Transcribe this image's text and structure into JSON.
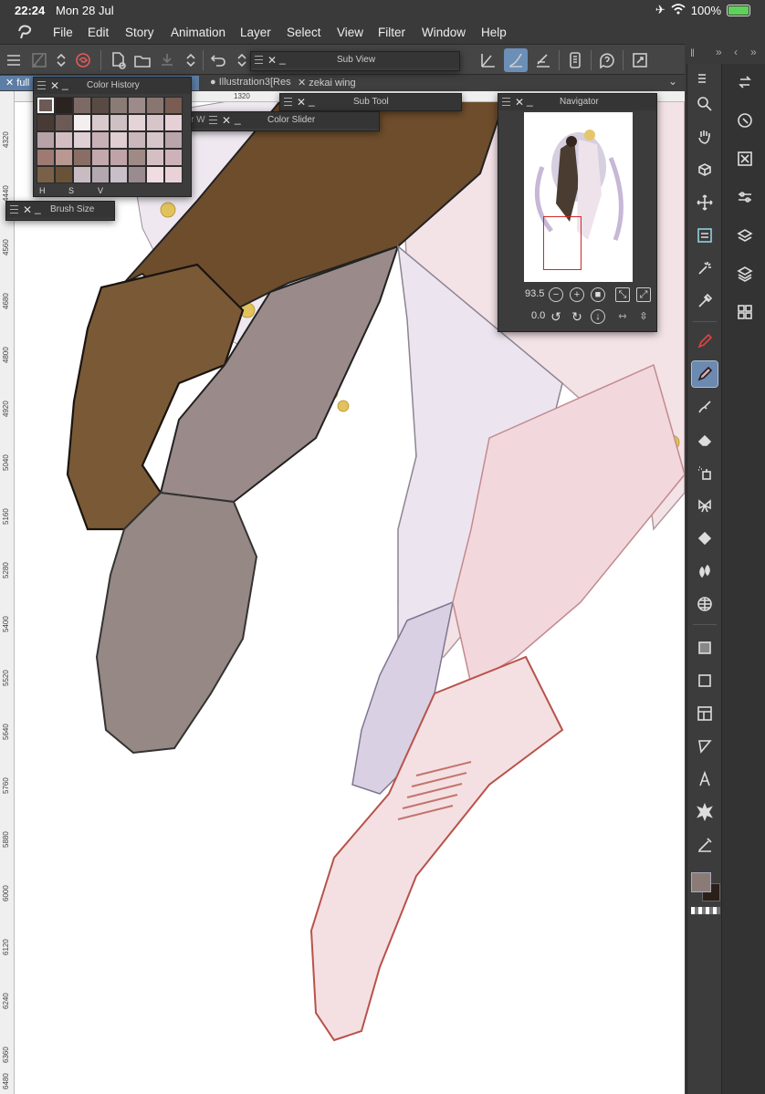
{
  "status_bar": {
    "time": "22:24",
    "date": "Mon 28 Jul",
    "battery": "100%",
    "battery_level": 1.0
  },
  "menu": {
    "items": [
      "File",
      "Edit",
      "Story",
      "Animation",
      "Layer",
      "Select",
      "View",
      "Filter",
      "Window",
      "Help"
    ]
  },
  "tabs": [
    {
      "label": "full"
    },
    {
      "label": "Illustration3[Res"
    },
    {
      "label": "zekai wing"
    }
  ],
  "ruler": {
    "vertical_ticks": [
      "4320",
      "4440",
      "4560",
      "4680",
      "4800",
      "4920",
      "5040",
      "5160",
      "5280",
      "5400",
      "5520",
      "5640",
      "5760",
      "5880",
      "6000",
      "6120",
      "6240",
      "6360",
      "6480"
    ],
    "horizontal_ticks": [
      "1320"
    ]
  },
  "palettes": {
    "color_history": {
      "title": "Color History",
      "tabs": [
        "H",
        "S",
        "V"
      ],
      "swatches": [
        "#6b5a55",
        "#2b2320",
        "#7d6a66",
        "#5a4a44",
        "#8b7b77",
        "#9c8b88",
        "#8a7670",
        "#7a5c52",
        "#4a3a36",
        "#6d5a57",
        "#f4eeee",
        "#d9c9cd",
        "#cfc0c4",
        "#e4d4d8",
        "#d8c5ca",
        "#e6d0d6",
        "#b7a2a7",
        "#d2bdc3",
        "#ddcfd3",
        "#c8b0b7",
        "#e0ced3",
        "#c9b7bc",
        "#d6c6ca",
        "#b9a5ab",
        "#9e7a72",
        "#b89890",
        "#8a6e66",
        "#c3a9ad",
        "#bfa3a8",
        "#a08a86",
        "#d5bfc5",
        "#cdb3b9",
        "#7a6048",
        "#6a5238",
        "#c8bcc2",
        "#b4a8b0",
        "#c9bfc8",
        "#9a8b8f",
        "#f1dce2",
        "#e8d2d8"
      ]
    },
    "color_slider": {
      "title": "Color Slider"
    },
    "color_wheel_fragment": {
      "title": "r W"
    },
    "brush_size": {
      "title": "Brush Size"
    },
    "sub_view": {
      "title": "Sub View"
    },
    "sub_tool": {
      "title": "Sub Tool"
    },
    "navigator": {
      "title": "Navigator",
      "zoom": "93.5",
      "rotation": "0.0"
    }
  },
  "colors": {
    "main_color": "#8b7b77",
    "sub_color": "#2b1f1a",
    "accent": "#6c89b0"
  },
  "toolbar_icons": [
    "menu-icon",
    "layer-icon",
    "stepper-icon",
    "logo-icon",
    "new-canvas-icon",
    "open-icon",
    "save-icon",
    "undo-icon",
    "redo-icon",
    "pen-icon",
    "brush-icon",
    "line-icon",
    "device-icon",
    "help-icon",
    "fullscreen-icon"
  ],
  "tool_icons": [
    "zoom-icon",
    "hand-icon",
    "rotate-3d-icon",
    "move-icon",
    "layer-move-icon",
    "auto-select-icon",
    "eyedropper-icon",
    "pen-icon",
    "pencil-icon",
    "brush-icon",
    "eraser-icon",
    "airbrush-icon",
    "decoration-icon",
    "fill-icon",
    "blend-icon",
    "perspective-icon",
    "gradient-icon",
    "rectangle-icon",
    "frame-icon",
    "ruler-icon",
    "text-icon",
    "balloon-icon",
    "correction-icon"
  ],
  "right_icons": [
    "swap-icon",
    "target-icon",
    "close-layer-icon",
    "sliders-icon",
    "layer-property-icon",
    "layers-icon",
    "material-icon"
  ]
}
